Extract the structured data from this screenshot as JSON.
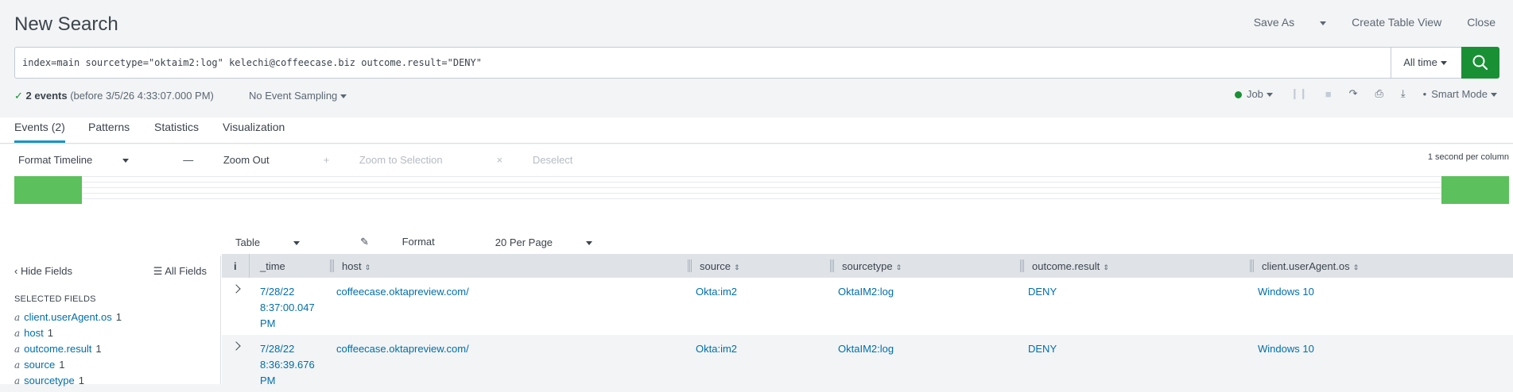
{
  "header": {
    "title": "New Search",
    "save_as": "Save As",
    "create_table_view": "Create Table View",
    "close": "Close"
  },
  "search": {
    "query": "index=main sourcetype=\"oktaim2:log\" kelechi@coffeecase.biz outcome.result=\"DENY\"",
    "time_range": "All time"
  },
  "status": {
    "events_bold": "2 events",
    "events_rest": "(before 3/5/26 4:33:07.000 PM)",
    "sampling": "No Event Sampling",
    "job": "Job",
    "mode": "Smart Mode"
  },
  "tabs": [
    {
      "label": "Events (2)",
      "active": true
    },
    {
      "label": "Patterns",
      "active": false
    },
    {
      "label": "Statistics",
      "active": false
    },
    {
      "label": "Visualization",
      "active": false
    }
  ],
  "timeline": {
    "format": "Format Timeline",
    "zoom_out": "Zoom Out",
    "zoom_selection": "Zoom to Selection",
    "deselect": "Deselect",
    "scale": "1 second per column"
  },
  "results_tools": {
    "table": "Table",
    "format": "Format",
    "per_page": "20 Per Page"
  },
  "sidebar": {
    "hide_fields": "Hide Fields",
    "all_fields": "All Fields",
    "selected_label": "SELECTED FIELDS",
    "fields": [
      {
        "type": "a",
        "name": "client.userAgent.os",
        "count": "1"
      },
      {
        "type": "a",
        "name": "host",
        "count": "1"
      },
      {
        "type": "a",
        "name": "outcome.result",
        "count": "1"
      },
      {
        "type": "a",
        "name": "source",
        "count": "1"
      },
      {
        "type": "a",
        "name": "sourcetype",
        "count": "1"
      }
    ]
  },
  "table": {
    "info": "i",
    "columns": [
      "_time",
      "host",
      "source",
      "sourcetype",
      "outcome.result",
      "client.userAgent.os"
    ],
    "rows": [
      {
        "time": [
          "7/28/22",
          "8:37:00.047",
          "PM"
        ],
        "host": "coffeecase.oktapreview.com/",
        "source": "Okta:im2",
        "sourcetype": "OktaIM2:log",
        "outcome": "DENY",
        "os": "Windows 10"
      },
      {
        "time": [
          "7/28/22",
          "8:36:39.676",
          "PM"
        ],
        "host": "coffeecase.oktapreview.com/",
        "source": "Okta:im2",
        "sourcetype": "OktaIM2:log",
        "outcome": "DENY",
        "os": "Windows 10"
      }
    ]
  },
  "colors": {
    "accent": "#1e93c6",
    "search_button": "#1a9035",
    "timeline_bar": "#5cc05c",
    "link": "#006eaa"
  }
}
